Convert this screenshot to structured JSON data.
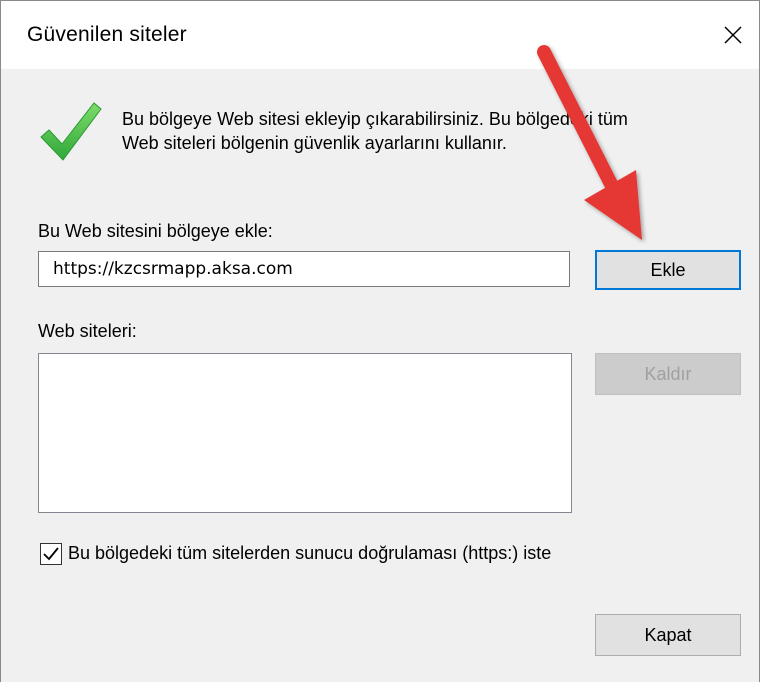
{
  "window": {
    "title": "Güvenilen siteler",
    "close_glyph": "✕"
  },
  "info": {
    "icon": "green-checkmark-icon",
    "line1": "Bu bölgeye Web sitesi ekleyip çıkarabilirsiniz. Bu bölgedeki tüm",
    "line2": "Web siteleri bölgenin güvenlik ayarlarını kullanır."
  },
  "add_site": {
    "label": "Bu Web sitesini bölgeye ekle:",
    "value": "https://kzcsrmapp.aksa.com",
    "button_label": "Ekle"
  },
  "sites": {
    "label": "Web siteleri:",
    "items": [],
    "remove_label": "Kaldır"
  },
  "https_option": {
    "checked": true,
    "label": "Bu bölgedeki tüm sitelerden sunucu doğrulaması (https:) iste"
  },
  "footer": {
    "close_label": "Kapat"
  },
  "annotation": {
    "arrow_color": "#e53935",
    "points_to": "add-button"
  },
  "colors": {
    "focus_border": "#0078d7",
    "check_green": "#3cba3c"
  }
}
